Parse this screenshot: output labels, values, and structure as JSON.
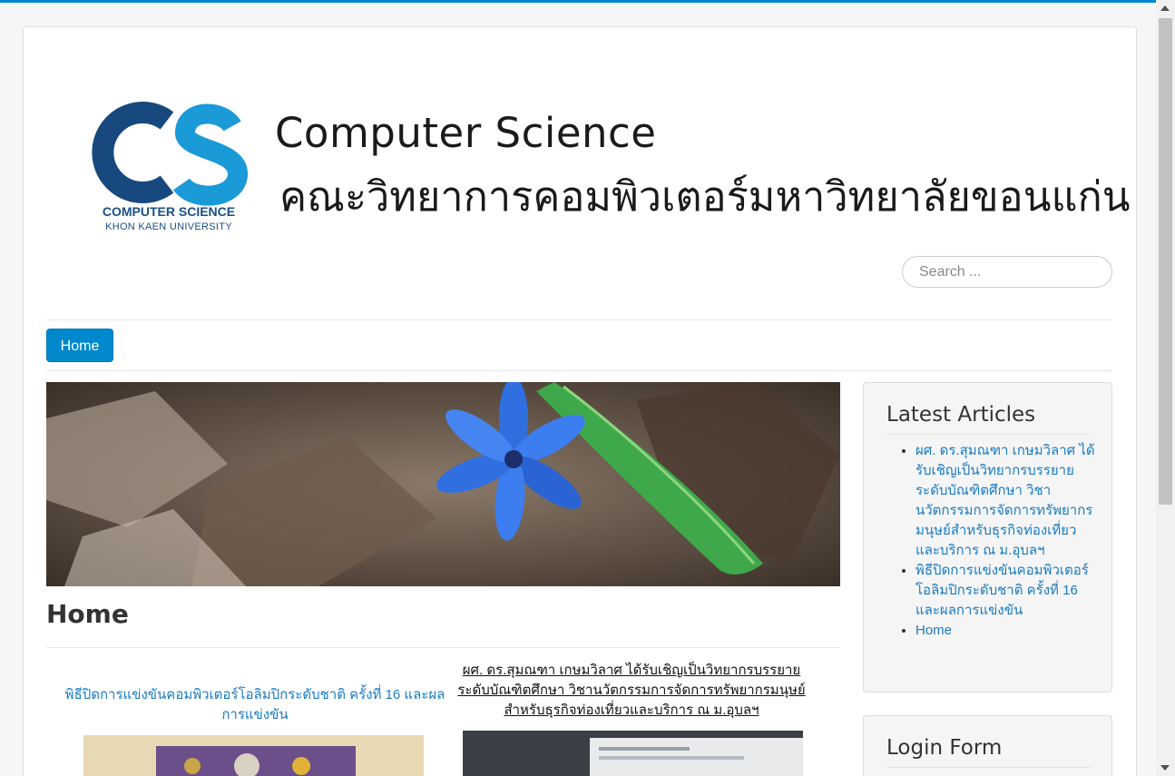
{
  "header": {
    "logo_title": "Computer Science",
    "logo_thai": "คณะวิทยาการคอมพิวเตอร์มหาวิทยาลัยขอนแก่น",
    "logo_cs_name": "COMPUTER SCIENCE",
    "logo_cs_university": "KHON KAEN UNIVERSITY",
    "brand_colors": {
      "dark_blue": "#17497f",
      "light_blue": "#1a9ad6"
    }
  },
  "search": {
    "placeholder": "Search ..."
  },
  "nav": {
    "items": [
      {
        "label": "Home",
        "active": true
      }
    ]
  },
  "main": {
    "title": "Home",
    "articles": [
      {
        "title": "พิธีปิดการแข่งขันคอมพิวเตอร์โอลิมปิกระดับชาติ ครั้งที่ 16 และผลการแข่งขัน"
      },
      {
        "title": "ผศ. ดร.สุมณฑา เกษมวิลาศ ได้รับเชิญเป็นวิทยากรบรรยาย ระดับบัณฑิตศึกษา วิชานวัตกรรมการจัดการทรัพยากรมนุษย์สำหรับธุรกิจท่องเที่ยวและบริการ ณ ม.อุบลฯ"
      }
    ]
  },
  "sidebar": {
    "latest_title": "Latest Articles",
    "latest_items": [
      {
        "label": "ผศ. ดร.สุมณฑา เกษมวิลาศ ได้รับเชิญเป็นวิทยากรบรรยาย ระดับบัณฑิตศึกษา วิชานวัตกรรมการจัดการทรัพยากรมนุษย์สำหรับธุรกิจท่องเที่ยวและบริการ ณ ม.อุบลฯ"
      },
      {
        "label": "พิธีปิดการแข่งขันคอมพิวเตอร์โอลิมปิกระดับชาติ ครั้งที่ 16 และผลการแข่งขัน"
      },
      {
        "label": "Home"
      }
    ],
    "login_title": "Login Form"
  },
  "accent_color": "#0088cc"
}
